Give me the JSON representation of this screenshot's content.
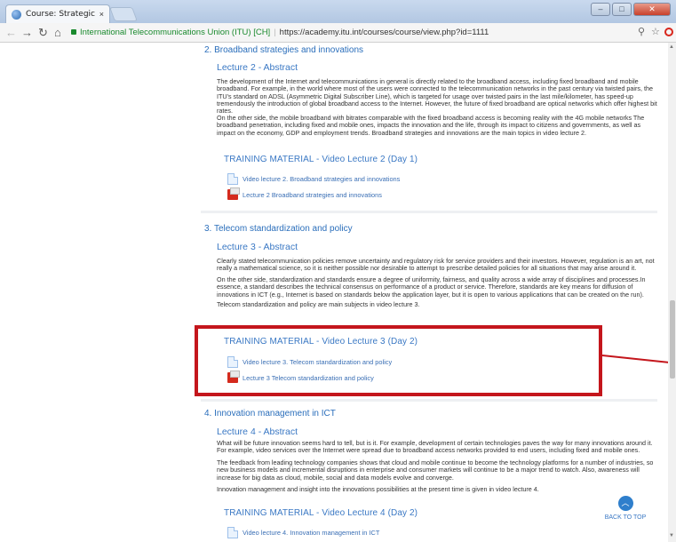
{
  "browser": {
    "tab_title": "Course: Strategic Aspects",
    "tab_close": "×",
    "secure_org": "International Telecommunications Union (ITU) [CH]",
    "url": "https://academy.itu.int/courses/course/view.php?id=1111"
  },
  "sections": [
    {
      "title": "2. Broadband strategies and innovations",
      "abstract_title": "Lecture 2 - Abstract",
      "paragraphs": [
        "The development of the Internet and telecommunications in general is directly related to the broadband access, including fixed broadband and mobile broadband. For example, in the world where most of the users were connected to the telecommunication networks in the past century via twisted pairs, the ITU's standard on ADSL (Asymmetric Digital Subscriber Line), which is targeted for usage over twisted pairs in the last mile/kilometer, has speed-up tremendously the introduction of global broadband access to the Internet. However, the future of fixed broadband are optical networks which offer highest bit rates.",
        "On the other side, the mobile broadband with bitrates comparable with the fixed broadband access is becoming reality with the 4G mobile networks The broadband penetration, including fixed and mobile ones, impacts the innovation and the life, through its impact to citizens and governments, as well as impact on the economy, GDP and employment trends. Broadband strategies and innovations are the main topics in video lecture 2."
      ],
      "training_title": "TRAINING MATERIAL - Video Lecture 2 (Day 1)",
      "resources": [
        {
          "type": "video",
          "label": "Video lecture 2. Broadband strategies and innovations"
        },
        {
          "type": "pdf",
          "label": "Lecture 2 Broadband strategies and innovations"
        }
      ]
    },
    {
      "title": "3. Telecom standardization and policy",
      "abstract_title": "Lecture 3 - Abstract",
      "paragraphs": [
        "Clearly stated telecommunication policies remove uncertainty and regulatory risk for service providers and their investors. However, regulation is an art, not really a mathematical science, so it is neither possible nor desirable to attempt to prescribe detailed policies for all situations that may arise around it.",
        "On the other side, standardization and standards ensure a degree of uniformity, fairness, and quality across a wide array of disciplines and processes.In essence, a standard describes the technical consensus on performance of a product or service. Therefore, standards are key means for diffusion of innovations in ICT (e.g., Internet is based on standards below the application layer, but it is open to various applications that can be created on the run).",
        "Telecom standardization and policy are main subjects in video lecture 3."
      ],
      "training_title": "TRAINING MATERIAL - Video Lecture 3 (Day 2)",
      "resources": [
        {
          "type": "video",
          "label": "Video lecture 3. Telecom standardization and policy"
        },
        {
          "type": "pdf",
          "label": "Lecture 3 Telecom standardization and policy"
        }
      ]
    },
    {
      "title": "4. Innovation management in ICT",
      "abstract_title": "Lecture 4 - Abstract",
      "paragraphs": [
        "What will be future innovation seems hard to tell, but is it. For example, development of certain technologies paves the way for many innovations around it. For example, video services over the Internet were spread due to broadband access networks provided to end users, including fixed and mobile ones.",
        "The feedback from leading technology companies shows that cloud and mobile continue to become the technology platforms for a number of industries, so new business models and incremental disruptions in enterprise and consumer markets will continue to be a major trend to watch. Also, awareness will increase for big data as cloud, mobile, social and data models evolve and converge.",
        "Innovation management and insight into the innovations possibilities at the present time is given in video lecture 4."
      ],
      "training_title": "TRAINING MATERIAL - Video Lecture 4 (Day 2)",
      "resources": [
        {
          "type": "video",
          "label": "Video lecture 4. Innovation management in ICT"
        }
      ]
    }
  ],
  "back_to_top": "BACK TO TOP",
  "colors": {
    "link_blue": "#3a78c4",
    "highlight_red": "#c4161c",
    "pdf_red": "#d42a1d"
  }
}
